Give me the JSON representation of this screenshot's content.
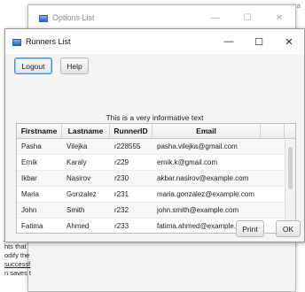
{
  "background": {
    "top_fragment": "na ~",
    "doc_lines": [
      "hts that",
      "odify the",
      "successf",
      "n saves t"
    ]
  },
  "options_window": {
    "title": "Options List",
    "controls": [
      "—",
      "☐",
      "✕"
    ]
  },
  "runners_window": {
    "title": "Runners List",
    "controls": [
      "—",
      "☐",
      "✕"
    ]
  },
  "toolbar": {
    "logout_label": "Logout",
    "help_label": "Help"
  },
  "info_text": "This is a very informative text",
  "table": {
    "columns": [
      "Firstname",
      "Lastname",
      "RunnerID",
      "Email"
    ],
    "rows": [
      [
        "Pasha",
        "Vilejka",
        "r228555",
        "pasha.vilejka@gmail.com"
      ],
      [
        "Ernik",
        "Karaly",
        "r229",
        "ernik.k@gmail.com"
      ],
      [
        "Ikbar",
        "Nasirov",
        "r230",
        "akbar.nasirov@example.com"
      ],
      [
        "Maria",
        "Gonzalez",
        "r231",
        "maria.gonzalez@example.com"
      ],
      [
        "John",
        "Smith",
        "r232",
        "john.smith@example.com"
      ],
      [
        "Fatima",
        "Ahmed",
        "r233",
        "fatima.ahmed@example.com"
      ]
    ]
  },
  "footer": {
    "print_label": "Print",
    "ok_label": "OK"
  }
}
